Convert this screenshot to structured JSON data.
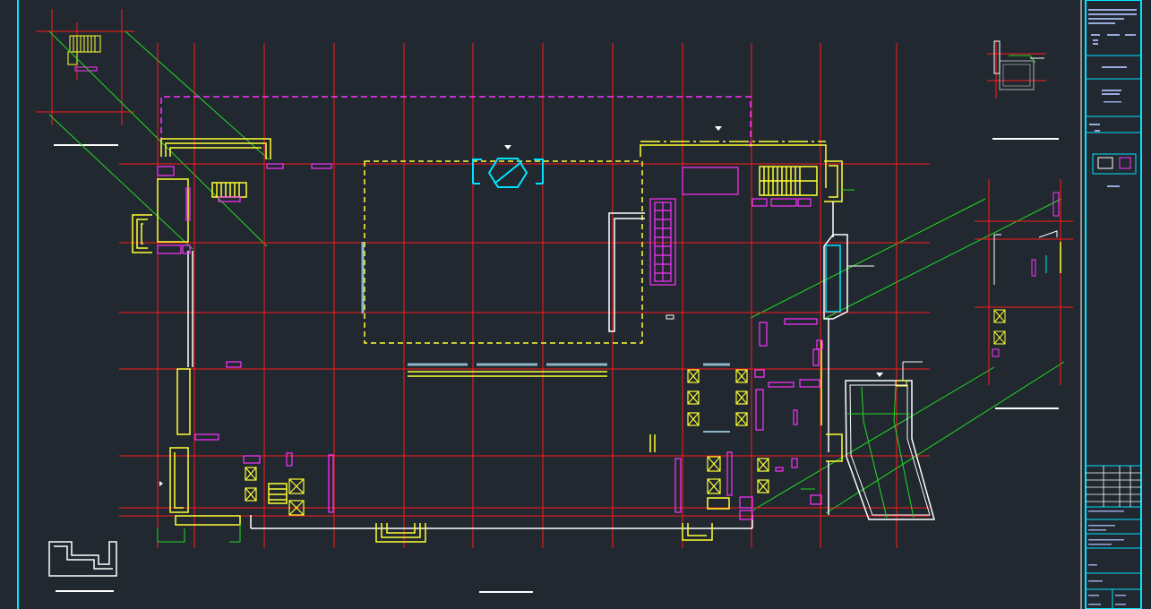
{
  "colors": {
    "background": "#212830",
    "grid_axis": "#ff1a1a",
    "wall": "#ffffff",
    "stair_fixture": "#ffff33",
    "equipment": "#ff33ff",
    "frame_border": "#00e5ff",
    "section_line": "#22dd22",
    "glazing": "#8fb5c8"
  },
  "icons": {
    "north_marker": "triangle-down-icon",
    "equipment_box": "crossed-box-icon"
  },
  "title_block": {
    "visible_text": []
  }
}
